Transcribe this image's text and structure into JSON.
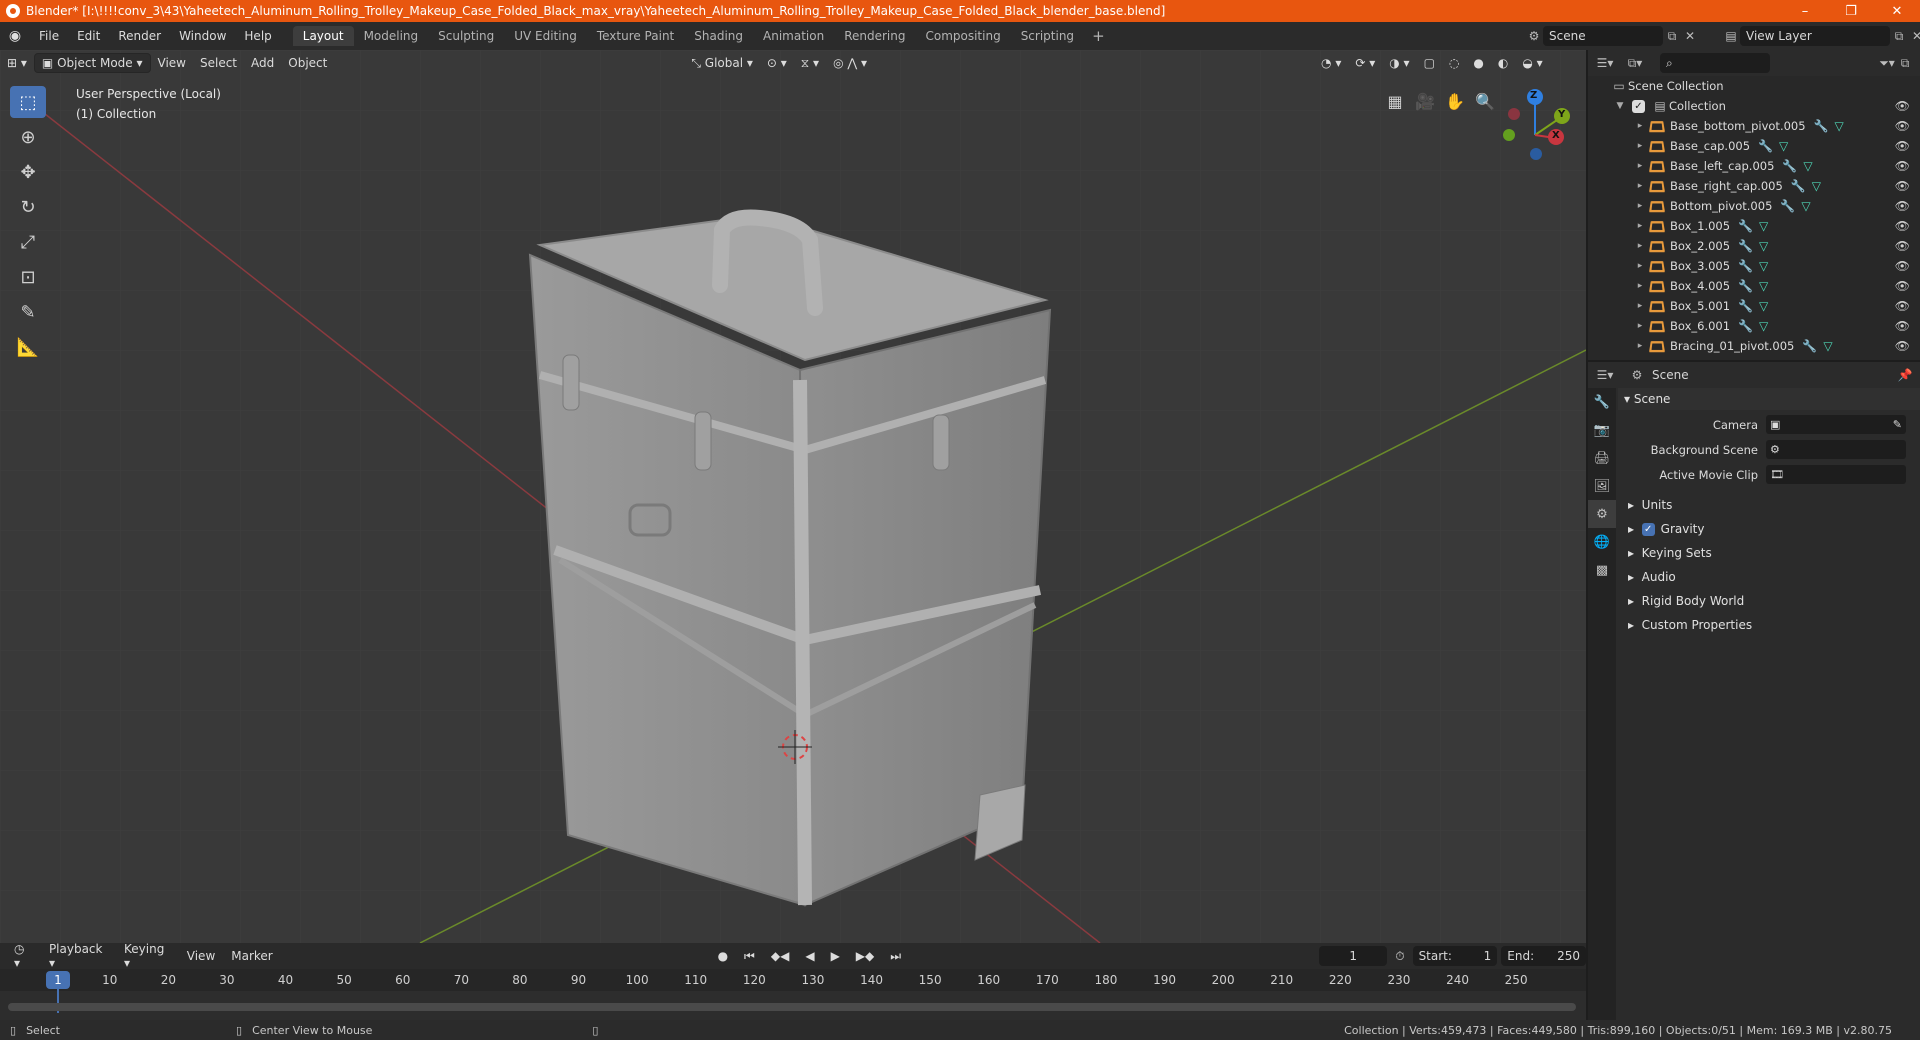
{
  "window": {
    "title": "Blender* [I:\\!!!!conv_3\\43\\Yaheetech_Aluminum_Rolling_Trolley_Makeup_Case_Folded_Black_max_vray\\Yaheetech_Aluminum_Rolling_Trolley_Makeup_Case_Folded_Black_blender_base.blend]",
    "minimize": "–",
    "maximize": "❐",
    "close": "✕"
  },
  "menu": {
    "items": [
      "File",
      "Edit",
      "Render",
      "Window",
      "Help"
    ],
    "workspaces": [
      "Layout",
      "Modeling",
      "Sculpting",
      "UV Editing",
      "Texture Paint",
      "Shading",
      "Animation",
      "Rendering",
      "Compositing",
      "Scripting"
    ],
    "active_workspace": "Layout",
    "scene": "Scene",
    "view_layer": "View Layer"
  },
  "viewport": {
    "mode": "Object Mode",
    "menus": [
      "View",
      "Select",
      "Add",
      "Object"
    ],
    "transform_orientation": "Global",
    "perspective_label": "User Perspective (Local)",
    "collection_label": "(1) Collection",
    "axes": {
      "x": "X",
      "y": "Y",
      "z": "Z"
    }
  },
  "timeline": {
    "menus": [
      "Playback",
      "Keying",
      "View",
      "Marker"
    ],
    "current_frame": "1",
    "start_label": "Start:",
    "start": "1",
    "end_label": "End:",
    "end": "250",
    "ruler": [
      "1",
      "10",
      "20",
      "30",
      "40",
      "50",
      "60",
      "70",
      "80",
      "90",
      "100",
      "110",
      "120",
      "130",
      "140",
      "150",
      "160",
      "170",
      "180",
      "190",
      "200",
      "210",
      "220",
      "230",
      "240",
      "250"
    ]
  },
  "statusbar": {
    "select": "Select",
    "center_view": "Center View to Mouse",
    "stats": "Collection | Verts:459,473 | Faces:449,580 | Tris:899,160 | Objects:0/51 | Mem: 169.3 MB | v2.80.75"
  },
  "outliner": {
    "root": "Scene Collection",
    "collection": "Collection",
    "objects": [
      "Base_bottom_pivot.005",
      "Base_cap.005",
      "Base_left_cap.005",
      "Base_right_cap.005",
      "Bottom_pivot.005",
      "Box_1.005",
      "Box_2.005",
      "Box_3.005",
      "Box_4.005",
      "Box_5.001",
      "Box_6.001",
      "Bracing_01_pivot.005"
    ]
  },
  "properties": {
    "context": "Scene",
    "panel_title": "Scene",
    "camera_label": "Camera",
    "background_scene_label": "Background Scene",
    "active_movie_clip_label": "Active Movie Clip",
    "subpanels": [
      "Units",
      "Gravity",
      "Keying Sets",
      "Audio",
      "Rigid Body World",
      "Custom Properties"
    ]
  },
  "colors": {
    "accent": "#4772b3",
    "titlebar": "#e8560f",
    "axis_x": "#c8363f",
    "axis_y": "#7ea51a",
    "axis_z": "#2f7fe0"
  }
}
